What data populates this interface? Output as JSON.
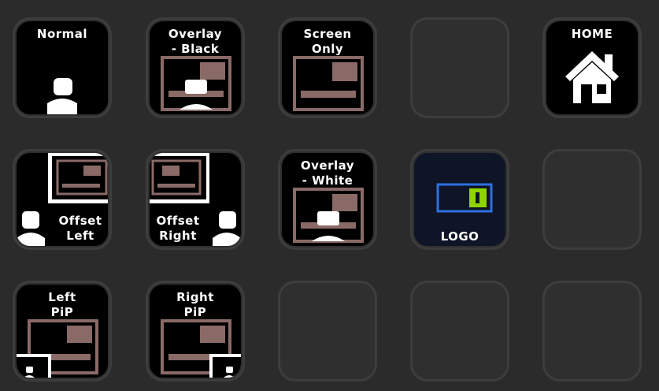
{
  "keys": {
    "normal": "Normal",
    "overlay_black": "Overlay\n- Black",
    "screen_only": "Screen\nOnly",
    "home": "HOME",
    "offset_left": "Offset\nLeft",
    "offset_right": "Offset\nRight",
    "overlay_white": "Overlay\n- White",
    "logo": "LOGO",
    "left_pip": "Left\nPiP",
    "right_pip": "Right\nPiP"
  },
  "colors": {
    "background": "#2b2b2b",
    "screen": "#8a6a67",
    "screen_dark": "#5a4341",
    "white": "#ffffff",
    "logo_bg": "#0e1526",
    "logo_outline": "#2f6fe0",
    "logo_led": "#8fd400"
  }
}
